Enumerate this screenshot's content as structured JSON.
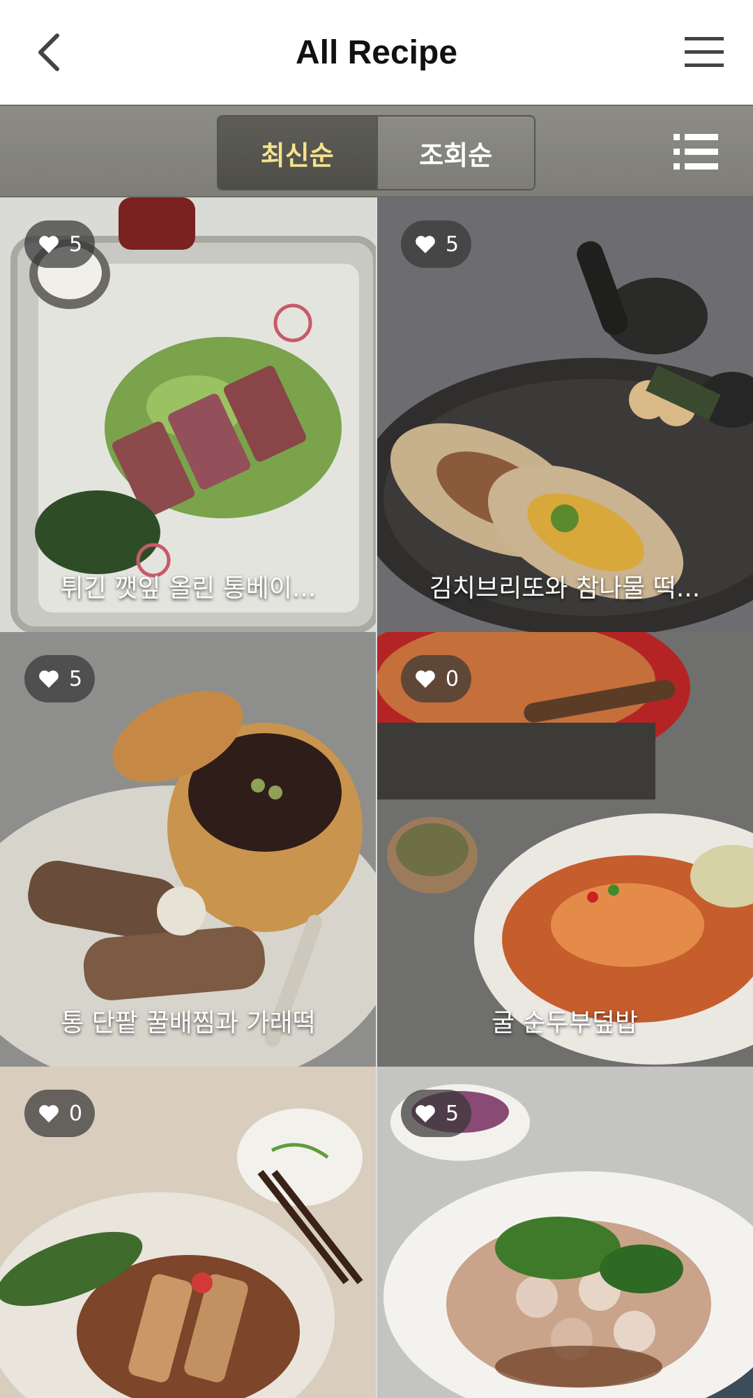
{
  "header": {
    "title": "All Recipe"
  },
  "toolbar": {
    "sort_latest": "최신순",
    "sort_views": "조회순"
  },
  "recipes": [
    {
      "likes": "5",
      "title": "튀긴 깻잎 올린 통베이..."
    },
    {
      "likes": "5",
      "title": "김치브리또와 참나물 떡..."
    },
    {
      "likes": "5",
      "title": "통 단팥 꿀배찜과 가래떡"
    },
    {
      "likes": "0",
      "title": "굴 순두부덮밥"
    },
    {
      "likes": "0",
      "title": ""
    },
    {
      "likes": "5",
      "title": ""
    }
  ],
  "colors": {
    "active_tab_text": "#f3e38e",
    "toolbar_bg": "#8d8c86"
  }
}
